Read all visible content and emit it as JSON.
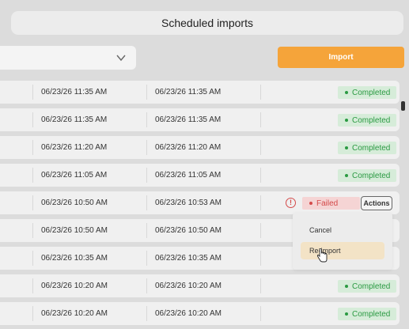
{
  "header": {
    "title": "Scheduled imports"
  },
  "toolbar": {
    "import_label": "Import"
  },
  "rows": [
    {
      "created": "06/23/26 11:35 AM",
      "updated": "06/23/26 11:35 AM",
      "status": "Completed"
    },
    {
      "created": "06/23/26 11:35 AM",
      "updated": "06/23/26 11:35 AM",
      "status": "Completed"
    },
    {
      "created": "06/23/26 11:20 AM",
      "updated": "06/23/26 11:20 AM",
      "status": "Completed"
    },
    {
      "created": "06/23/26 11:05 AM",
      "updated": "06/23/26 11:05 AM",
      "status": "Completed"
    },
    {
      "created": "06/23/26 10:50 AM",
      "updated": "06/23/26 10:53 AM",
      "status": "Failed",
      "actions_label": "Actions",
      "warning_icon": "!"
    },
    {
      "created": "06/23/26 10:50 AM",
      "updated": "06/23/26 10:50 AM",
      "status": ""
    },
    {
      "created": "06/23/26 10:35 AM",
      "updated": "06/23/26 10:35 AM",
      "status": ""
    },
    {
      "created": "06/23/26 10:20 AM",
      "updated": "06/23/26 10:20 AM",
      "status": "Completed"
    },
    {
      "created": "06/23/26 10:20 AM",
      "updated": "06/23/26 10:20 AM",
      "status": "Completed"
    }
  ],
  "actions_menu": {
    "items": [
      "Cancel",
      "Re-import"
    ]
  },
  "colors": {
    "accent": "#f5a43a",
    "success": "#2a9a42",
    "danger": "#d44a4a"
  }
}
